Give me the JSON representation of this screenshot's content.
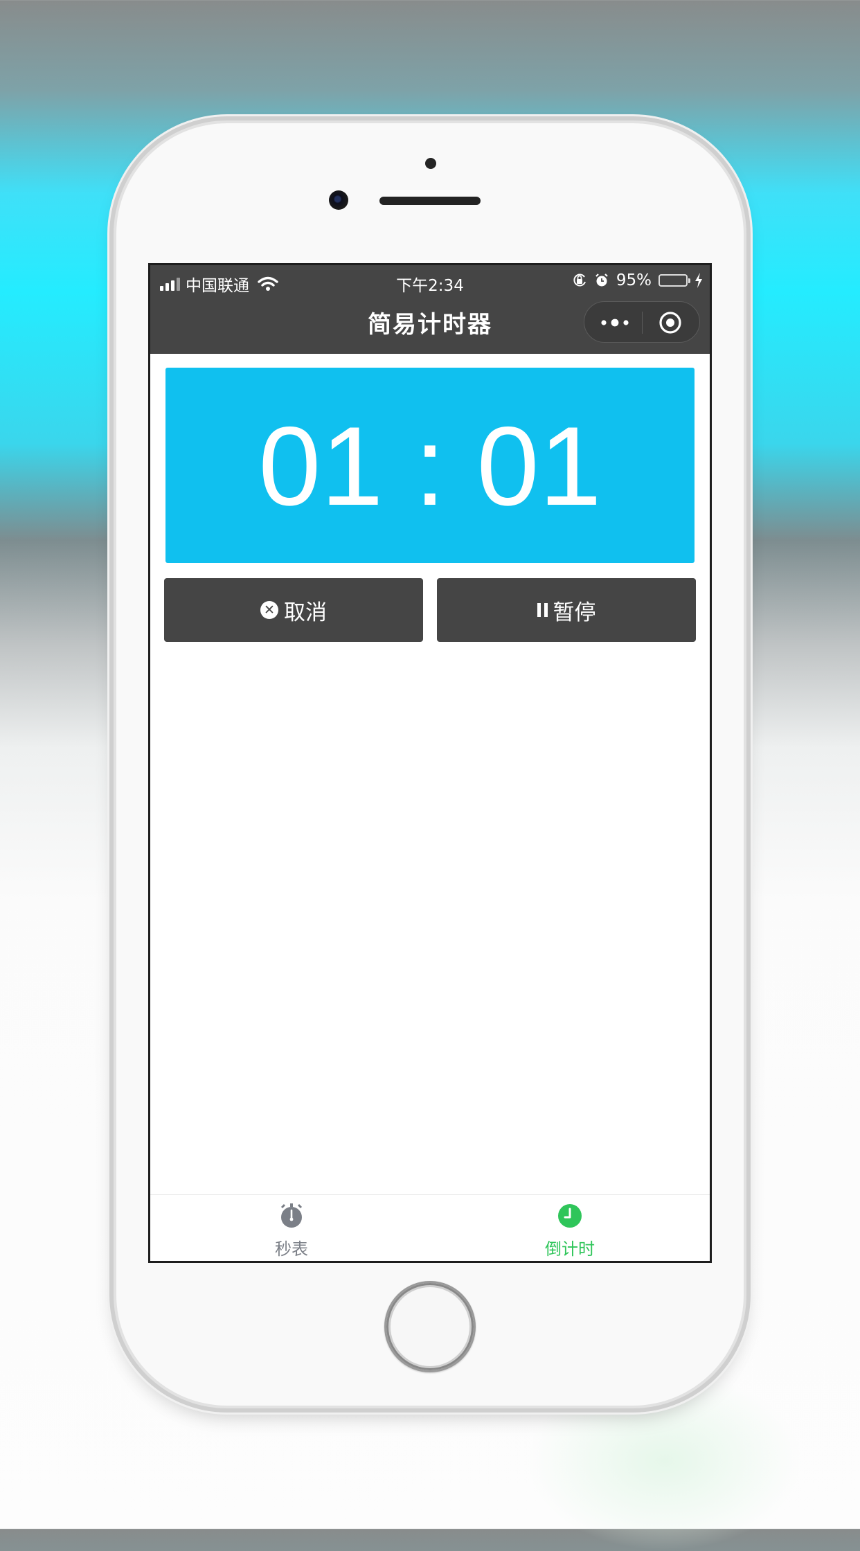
{
  "status_bar": {
    "carrier": "中国联通",
    "time": "下午2:34",
    "battery": "95%",
    "battery_level": 0.95
  },
  "nav": {
    "title": "简易计时器",
    "more_icon": "more-dots-icon",
    "close_icon": "target-close-icon"
  },
  "timer": {
    "display": "01 : 01",
    "background_color": "#10c0ef"
  },
  "buttons": {
    "cancel_label": "取消",
    "pause_label": "暂停"
  },
  "tabbar": {
    "items": [
      {
        "label": "秒表",
        "icon": "stopwatch-icon",
        "active": false
      },
      {
        "label": "倒计时",
        "icon": "clock-icon",
        "active": true
      }
    ],
    "active_color": "#2fc55a"
  }
}
